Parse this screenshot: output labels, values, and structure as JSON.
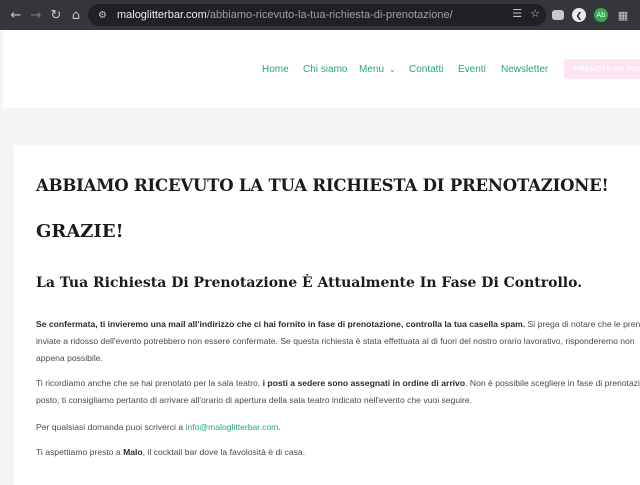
{
  "browser": {
    "url_domain": "maloglitterbar.com",
    "url_path": "/abbiamo-ricevuto-la-tua-richiesta-di-prenotazione/",
    "icons": [
      "back-icon",
      "forward-icon",
      "reload-icon",
      "home-icon",
      "site-settings-icon",
      "translate-icon",
      "bookmark-star-icon",
      "camera-extension-icon",
      "arrow-extension-icon",
      "ab-extension-icon",
      "puzzle-icon",
      "side-panel-icon"
    ],
    "ext_label_ab": "Ab"
  },
  "nav": {
    "home": "Home",
    "chi_siamo": "Chi siamo",
    "menu": "Menu",
    "contatti": "Contatti",
    "eventi": "Eventi",
    "newsletter": "Newsletter",
    "cta": "PRENOTA UN POSTO"
  },
  "content": {
    "title": "ABBIAMO RICEVUTO LA TUA RICHIESTA DI PRENOTAZIONE!",
    "thanks": "GRAZIE!",
    "subtitle": "La Tua Richiesta Di Prenotazione È Attualmente In Fase Di Controllo.",
    "p1_bold": "Se confermata, ti invieremo una mail all'indirizzo che ci hai fornito in fase di prenotazione, controlla la tua casella spam.",
    "p1_rest": " Si prega di notare che le prenotazioni",
    "p1_line2": "inviate a ridosso dell'evento potrebbero non essere confermate. Se questa richiesta è stata effettuata al di fuori del nostro orario lavorativo, risponderemo non",
    "p1_line3": "appena possibile.",
    "p2_start": "Ti ricordiamo anche che se hai prenotato per la sala teatro, ",
    "p2_bold": "i posti a sedere sono assegnati in ordine di arrivo",
    "p2_rest": ". Non è possibile scegliere in fase di prenotazione il",
    "p2_line2": "posto, ti consigliamo pertanto di arrivare all'orario di apertura della sala teatro indicato nell'evento che vuoi seguire.",
    "p3_start": "Per qualsiasi domanda puoi scriverci a ",
    "p3_email": "info@maloglitterbar.com",
    "p3_end": ".",
    "p4_start": "Ti aspettiamo presto a ",
    "p4_bold": "Malo",
    "p4_rest": ", il cocktail bar dove la favolosità è di casa."
  },
  "colors": {
    "accent": "#2aa37c",
    "cta_bg": "#fde4f1",
    "chrome": "#35363a"
  }
}
